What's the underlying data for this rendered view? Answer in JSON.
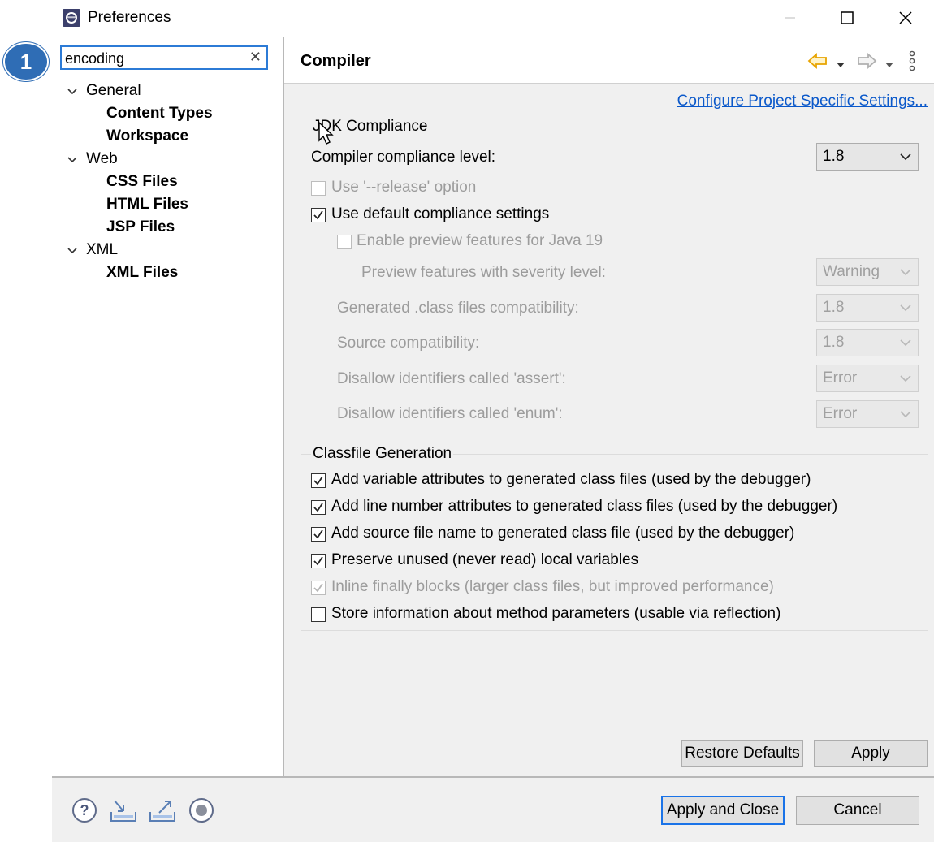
{
  "window": {
    "title": "Preferences"
  },
  "badge": {
    "number": "1"
  },
  "search": {
    "value": "encoding",
    "placeholder": ""
  },
  "tree": {
    "groups": [
      {
        "label": "General",
        "children": [
          "Content Types",
          "Workspace"
        ]
      },
      {
        "label": "Web",
        "children": [
          "CSS Files",
          "HTML Files",
          "JSP Files"
        ]
      },
      {
        "label": "XML",
        "children": [
          "XML Files"
        ]
      }
    ]
  },
  "page": {
    "title": "Compiler",
    "config_link": "Configure Project Specific Settings..."
  },
  "jdk": {
    "legend": "JDK Compliance",
    "compliance_label": "Compiler compliance level:",
    "compliance_value": "1.8",
    "release_option": {
      "label": "Use '--release' option",
      "checked": false,
      "enabled": false
    },
    "default_settings": {
      "label": "Use default compliance settings",
      "checked": true,
      "enabled": true
    },
    "preview": {
      "label": "Enable preview features for Java 19",
      "checked": false,
      "enabled": false
    },
    "preview_severity": {
      "label": "Preview features with severity level:",
      "value": "Warning"
    },
    "class_compat": {
      "label": "Generated .class files compatibility:",
      "value": "1.8"
    },
    "source_compat": {
      "label": "Source compatibility:",
      "value": "1.8"
    },
    "assert_ident": {
      "label": "Disallow identifiers called 'assert':",
      "value": "Error"
    },
    "enum_ident": {
      "label": "Disallow identifiers called 'enum':",
      "value": "Error"
    }
  },
  "classfile": {
    "legend": "Classfile Generation",
    "options": [
      {
        "label": "Add variable attributes to generated class files (used by the debugger)",
        "checked": true,
        "enabled": true
      },
      {
        "label": "Add line number attributes to generated class files (used by the debugger)",
        "checked": true,
        "enabled": true
      },
      {
        "label": "Add source file name to generated class file (used by the debugger)",
        "checked": true,
        "enabled": true
      },
      {
        "label": "Preserve unused (never read) local variables",
        "checked": true,
        "enabled": true
      },
      {
        "label": "Inline finally blocks (larger class files, but improved performance)",
        "checked": true,
        "enabled": false
      },
      {
        "label": "Store information about method parameters (usable via reflection)",
        "checked": false,
        "enabled": true
      }
    ]
  },
  "buttons": {
    "restore_defaults": "Restore Defaults",
    "apply": "Apply",
    "apply_and_close": "Apply and Close",
    "cancel": "Cancel"
  },
  "icons": {
    "app": "eclipse-icon",
    "clear": "clear-icon",
    "back": "back-arrow-icon",
    "forward": "forward-arrow-icon",
    "menu": "view-menu-icon",
    "help": "help-icon",
    "import": "import-icon",
    "export": "export-icon",
    "record": "record-icon"
  },
  "colors": {
    "link": "#0a58ca",
    "focus": "#1a73e8",
    "badge": "#2f6db5",
    "back_arrow": "#e8a400"
  }
}
